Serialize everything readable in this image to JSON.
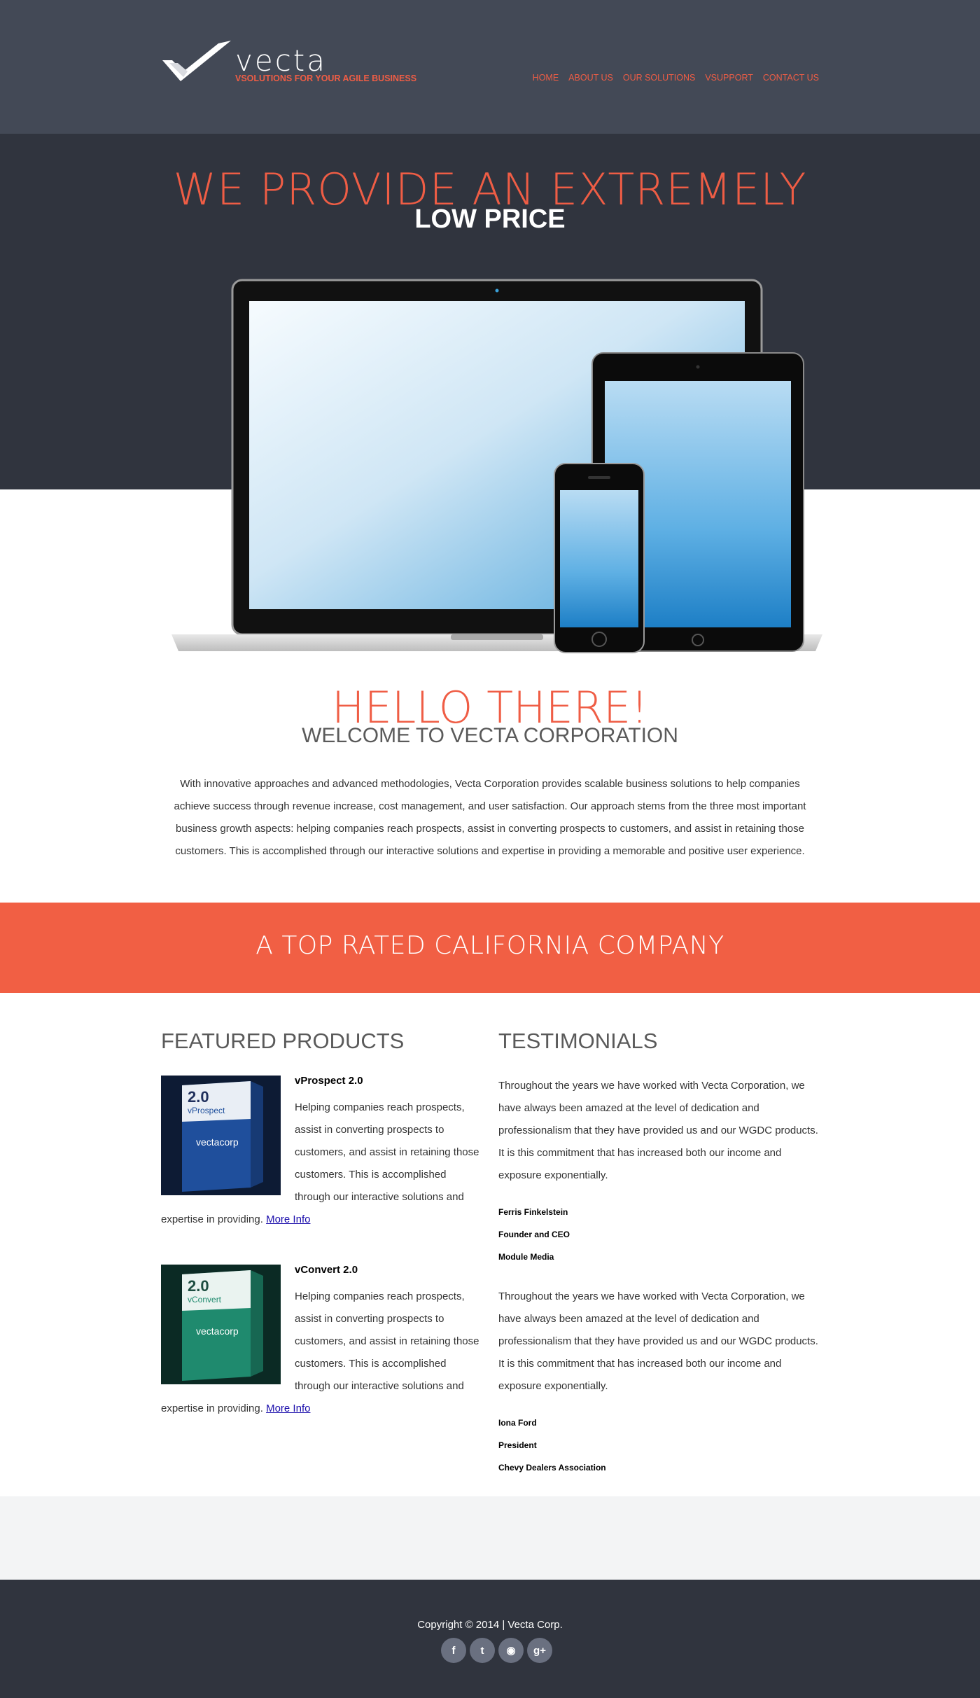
{
  "header": {
    "logo_word": "vecta",
    "tagline": "VSOLUTIONS FOR YOUR AGILE BUSINESS",
    "nav": [
      "HOME",
      "ABOUT US",
      "OUR SOLUTIONS",
      "VSUPPORT",
      "CONTACT US"
    ]
  },
  "hero": {
    "line1": "WE PROVIDE AN EXTREMELY",
    "line2": "LOW PRICE"
  },
  "welcome": {
    "hello": "HELLO THERE!",
    "title": "WELCOME TO VECTA CORPORATION",
    "body": "With innovative approaches and advanced methodologies, Vecta Corporation provides scalable business solutions to help companies achieve success through revenue increase, cost management, and user satisfaction. Our approach stems from the three most important business growth aspects: helping companies reach prospects, assist in converting prospects to customers, and assist in retaining those customers. This is accomplished through our interactive solutions and expertise in providing a memorable and positive user experience."
  },
  "banner": {
    "text": "A TOP RATED CALIFORNIA COMPANY"
  },
  "featured": {
    "title": "FEATURED PRODUCTS",
    "products": [
      {
        "name": "vProspect 2.0",
        "box_version": "2.0",
        "box_name": "vProspect",
        "box_brand": "vectacorp",
        "color": "#1f4f9c",
        "desc": "Helping companies reach prospects, assist in converting prospects to customers, and assist in retaining those customers. This is accomplished through our interactive solutions and expertise in providing.",
        "link": "More Info"
      },
      {
        "name": "vConvert 2.0",
        "box_version": "2.0",
        "box_name": "vConvert",
        "box_brand": "vectacorp",
        "color": "#1f8a6e",
        "desc": "Helping companies reach prospects, assist in converting prospects to customers, and assist in retaining those customers. This is accomplished through our interactive solutions and expertise in providing.",
        "link": "More Info"
      }
    ]
  },
  "testimonials": {
    "title": "TESTIMONIALS",
    "items": [
      {
        "quote": "Throughout the years we have worked with Vecta Corporation, we have always been amazed at the level of dedication and professionalism that they have provided us and our WGDC products. It is this commitment that has increased both our income and exposure exponentially.",
        "name": "Ferris Finkelstein",
        "role": "Founder and CEO",
        "company": "Module Media"
      },
      {
        "quote": "Throughout the years we have worked with Vecta Corporation, we have always been amazed at the level of dedication and professionalism that they have provided us and our WGDC products. It is this commitment that has increased both our income and exposure exponentially.",
        "name": "Iona Ford",
        "role": "President",
        "company": "Chevy Dealers Association"
      }
    ]
  },
  "footer": {
    "copyright": "Copyright © 2014 | Vecta Corp.",
    "social": [
      {
        "icon": "facebook-icon",
        "glyph": "f"
      },
      {
        "icon": "twitter-icon",
        "glyph": "t"
      },
      {
        "icon": "rss-icon",
        "glyph": "◉"
      },
      {
        "icon": "google-plus-icon",
        "glyph": "g+"
      }
    ]
  },
  "colors": {
    "accent": "#ef5d45",
    "header_bg": "#434956",
    "dark_bg": "#30343e",
    "banner_bg": "#f15f44"
  }
}
